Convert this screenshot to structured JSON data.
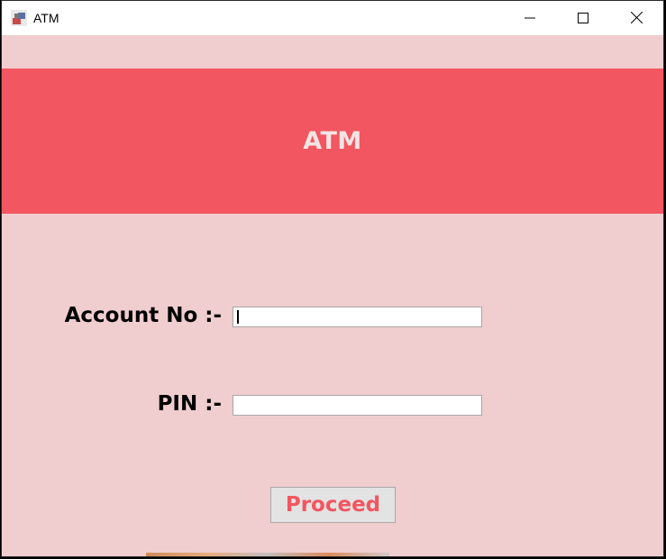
{
  "window": {
    "title": "ATM"
  },
  "header": {
    "title": "ATM"
  },
  "form": {
    "account_label": "Account No :-",
    "account_value": "",
    "pin_label": "PIN :-",
    "pin_value": "",
    "proceed_label": "Proceed"
  },
  "colors": {
    "background": "#f0cdcf",
    "header": "#f25660",
    "header_text": "#f3e4e4",
    "button_text": "#f25660"
  },
  "icons": {
    "app": "app-icon",
    "minimize": "minimize-icon",
    "maximize": "maximize-icon",
    "close": "close-icon"
  }
}
